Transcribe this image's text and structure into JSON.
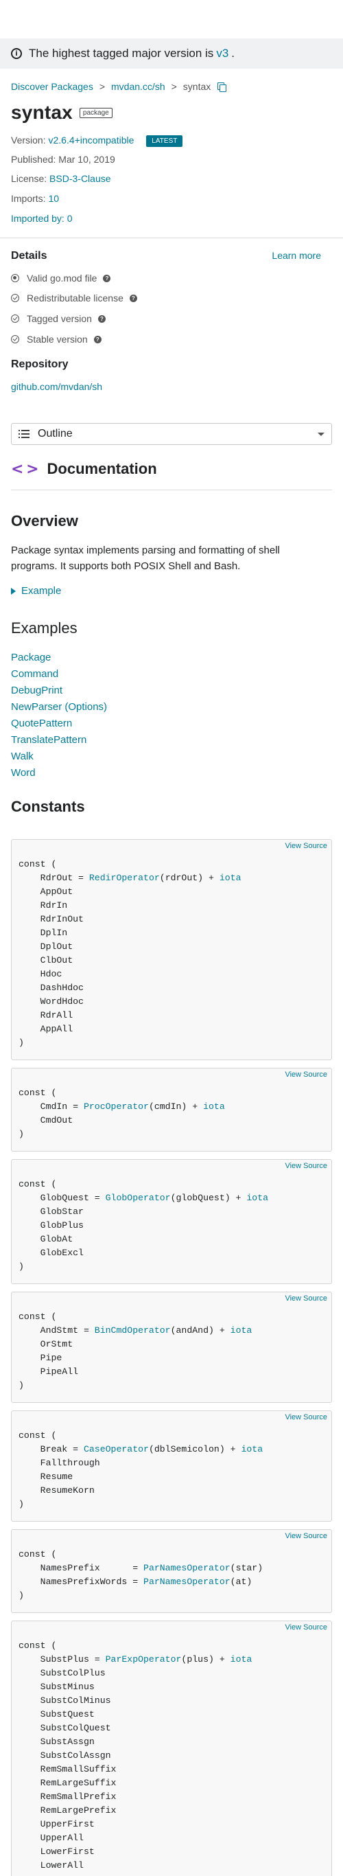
{
  "banner": {
    "text": "The highest tagged major version is",
    "version": "v3",
    "suffix": "."
  },
  "breadcrumb": {
    "items": [
      "Discover Packages",
      "mvdan.cc/sh",
      "syntax"
    ],
    "separator": ">"
  },
  "package": {
    "name": "syntax",
    "badge": "package",
    "version_label": "Version:",
    "version": "v2.6.4+incompatible",
    "latest_badge": "LATEST",
    "published_label": "Published:",
    "published": "Mar 10, 2019",
    "license_label": "License:",
    "license": "BSD-3-Clause",
    "imports_label": "Imports:",
    "imports": "10",
    "imported_by": "Imported by: 0"
  },
  "details": {
    "heading": "Details",
    "learn_more": "Learn more",
    "checks": [
      {
        "label": "Valid go.mod file",
        "status": "missing"
      },
      {
        "label": "Redistributable license",
        "status": "ok"
      },
      {
        "label": "Tagged version",
        "status": "ok"
      },
      {
        "label": "Stable version",
        "status": "ok"
      }
    ]
  },
  "repository": {
    "heading": "Repository",
    "link": "github.com/mvdan/sh"
  },
  "outline": {
    "label": "Outline"
  },
  "documentation": {
    "heading": "Documentation",
    "overview_heading": "Overview",
    "overview_text": "Package syntax implements parsing and formatting of shell programs. It supports both POSIX Shell and Bash.",
    "example_toggle": "Example",
    "examples_heading": "Examples",
    "examples": [
      "Package",
      "Command",
      "DebugPrint",
      "NewParser (Options)",
      "QuotePattern",
      "TranslatePattern",
      "Walk",
      "Word"
    ],
    "constants_heading": "Constants",
    "view_source": "View Source"
  },
  "code_blocks": [
    {
      "first": {
        "pre": "    RdrOut = ",
        "fn": "RedirOperator",
        "arg": "(rdrOut) + ",
        "kw": "iota"
      },
      "names": [
        "AppOut",
        "RdrIn",
        "RdrInOut",
        "DplIn",
        "DplOut",
        "ClbOut",
        "Hdoc",
        "DashHdoc",
        "WordHdoc",
        "RdrAll",
        "AppAll"
      ]
    },
    {
      "first": {
        "pre": "    CmdIn = ",
        "fn": "ProcOperator",
        "arg": "(cmdIn) + ",
        "kw": "iota"
      },
      "names": [
        "CmdOut"
      ]
    },
    {
      "first": {
        "pre": "    GlobQuest = ",
        "fn": "GlobOperator",
        "arg": "(globQuest) + ",
        "kw": "iota"
      },
      "names": [
        "GlobStar",
        "GlobPlus",
        "GlobAt",
        "GlobExcl"
      ]
    },
    {
      "first": {
        "pre": "    AndStmt = ",
        "fn": "BinCmdOperator",
        "arg": "(andAnd) + ",
        "kw": "iota"
      },
      "names": [
        "OrStmt",
        "Pipe",
        "PipeAll"
      ]
    },
    {
      "first": {
        "pre": "    Break = ",
        "fn": "CaseOperator",
        "arg": "(dblSemicolon) + ",
        "kw": "iota"
      },
      "names": [
        "Fallthrough",
        "Resume",
        "ResumeKorn"
      ]
    },
    {
      "first": {
        "pre": "    NamesPrefix      = ",
        "fn": "ParNamesOperator",
        "arg": "(star)",
        "kw": ""
      },
      "second": {
        "pre": "    NamesPrefixWords = ",
        "fn": "ParNamesOperator",
        "arg": "(at)",
        "kw": ""
      },
      "names": []
    },
    {
      "first": {
        "pre": "    SubstPlus = ",
        "fn": "ParExpOperator",
        "arg": "(plus) + ",
        "kw": "iota"
      },
      "names": [
        "SubstColPlus",
        "SubstMinus",
        "SubstColMinus",
        "SubstQuest",
        "SubstColQuest",
        "SubstAssgn",
        "SubstColAssgn",
        "RemSmallSuffix",
        "RemLargeSuffix",
        "RemSmallPrefix",
        "RemLargePrefix",
        "UpperFirst",
        "UpperAll",
        "LowerFirst",
        "LowerAll"
      ]
    }
  ],
  "code_keywords": {
    "open": "const (",
    "close": ")"
  },
  "colors": {
    "link": "#007d9c",
    "latest_bg": "#00758f",
    "doc_icon": "#7f3fbf",
    "banner_bg": "#f0f1f2"
  }
}
